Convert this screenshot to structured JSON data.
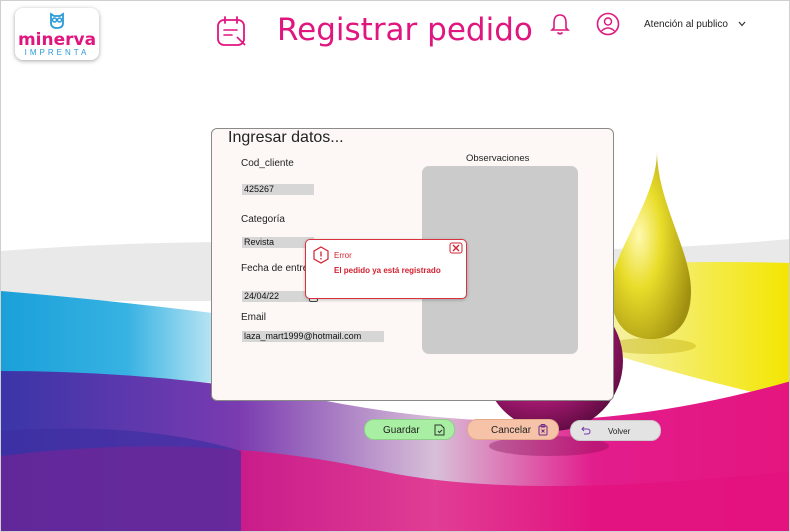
{
  "brand": {
    "name": "minerva",
    "subtitle": "IMPRENTA"
  },
  "header": {
    "title": "Registrar pedido",
    "user_role": "Atención al publico"
  },
  "form": {
    "heading": "Ingresar datos...",
    "cod_cliente": {
      "label": "Cod_cliente",
      "value": "425267"
    },
    "categoria": {
      "label": "Categoría",
      "value": "Revista"
    },
    "fecha": {
      "label": "Fecha de entre",
      "value": "24/04/22"
    },
    "email": {
      "label": "Email",
      "value": "laza_mart1999@hotmail.com"
    },
    "observaciones": {
      "label": "Observaciones",
      "value": ""
    }
  },
  "dialog": {
    "title": "Error",
    "message": "El pedido ya está registrado"
  },
  "buttons": {
    "save": "Guardar",
    "cancel": "Cancelar",
    "back": "Volver"
  },
  "colors": {
    "accent": "#e0167f",
    "logo_blue": "#2a9ad8",
    "error": "#d32030",
    "save_bg": "#a8efa3",
    "cancel_bg": "#f6c3a8",
    "back_bg": "#e3e3e3"
  }
}
